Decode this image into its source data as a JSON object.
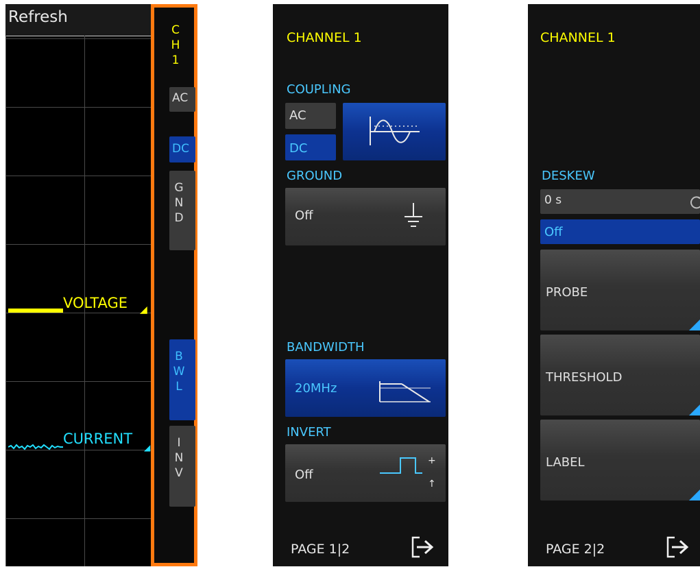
{
  "scope": {
    "refresh_label": "Refresh",
    "voltage_label": "VOLTAGE",
    "current_label": "CURRENT",
    "side_menu": {
      "channel": [
        "C",
        "H",
        "1"
      ],
      "ac": "AC",
      "dc": "DC",
      "gnd": [
        "G",
        "N",
        "D"
      ],
      "bwl": [
        "B",
        "W",
        "L"
      ],
      "inv": [
        "I",
        "N",
        "V"
      ]
    }
  },
  "page1": {
    "title": "CHANNEL 1",
    "coupling": {
      "label": "COUPLING",
      "ac": "AC",
      "dc": "DC",
      "selected": "DC"
    },
    "ground": {
      "label": "GROUND",
      "value": "Off"
    },
    "bandwidth": {
      "label": "BANDWIDTH",
      "value": "20MHz"
    },
    "invert": {
      "label": "INVERT",
      "value": "Off"
    },
    "page": "PAGE 1|2"
  },
  "page2": {
    "title": "CHANNEL 1",
    "deskew": {
      "label": "DESKEW",
      "value": "0 s",
      "state": "Off"
    },
    "probe": "PROBE",
    "threshold": "THRESHOLD",
    "label_btn": "LABEL",
    "page": "PAGE 2|2"
  },
  "colors": {
    "accent_yellow": "#ffff00",
    "accent_cyan": "#4ac8ff",
    "selected_blue": "#0f3aa0",
    "highlight_orange": "#ff7a10"
  }
}
